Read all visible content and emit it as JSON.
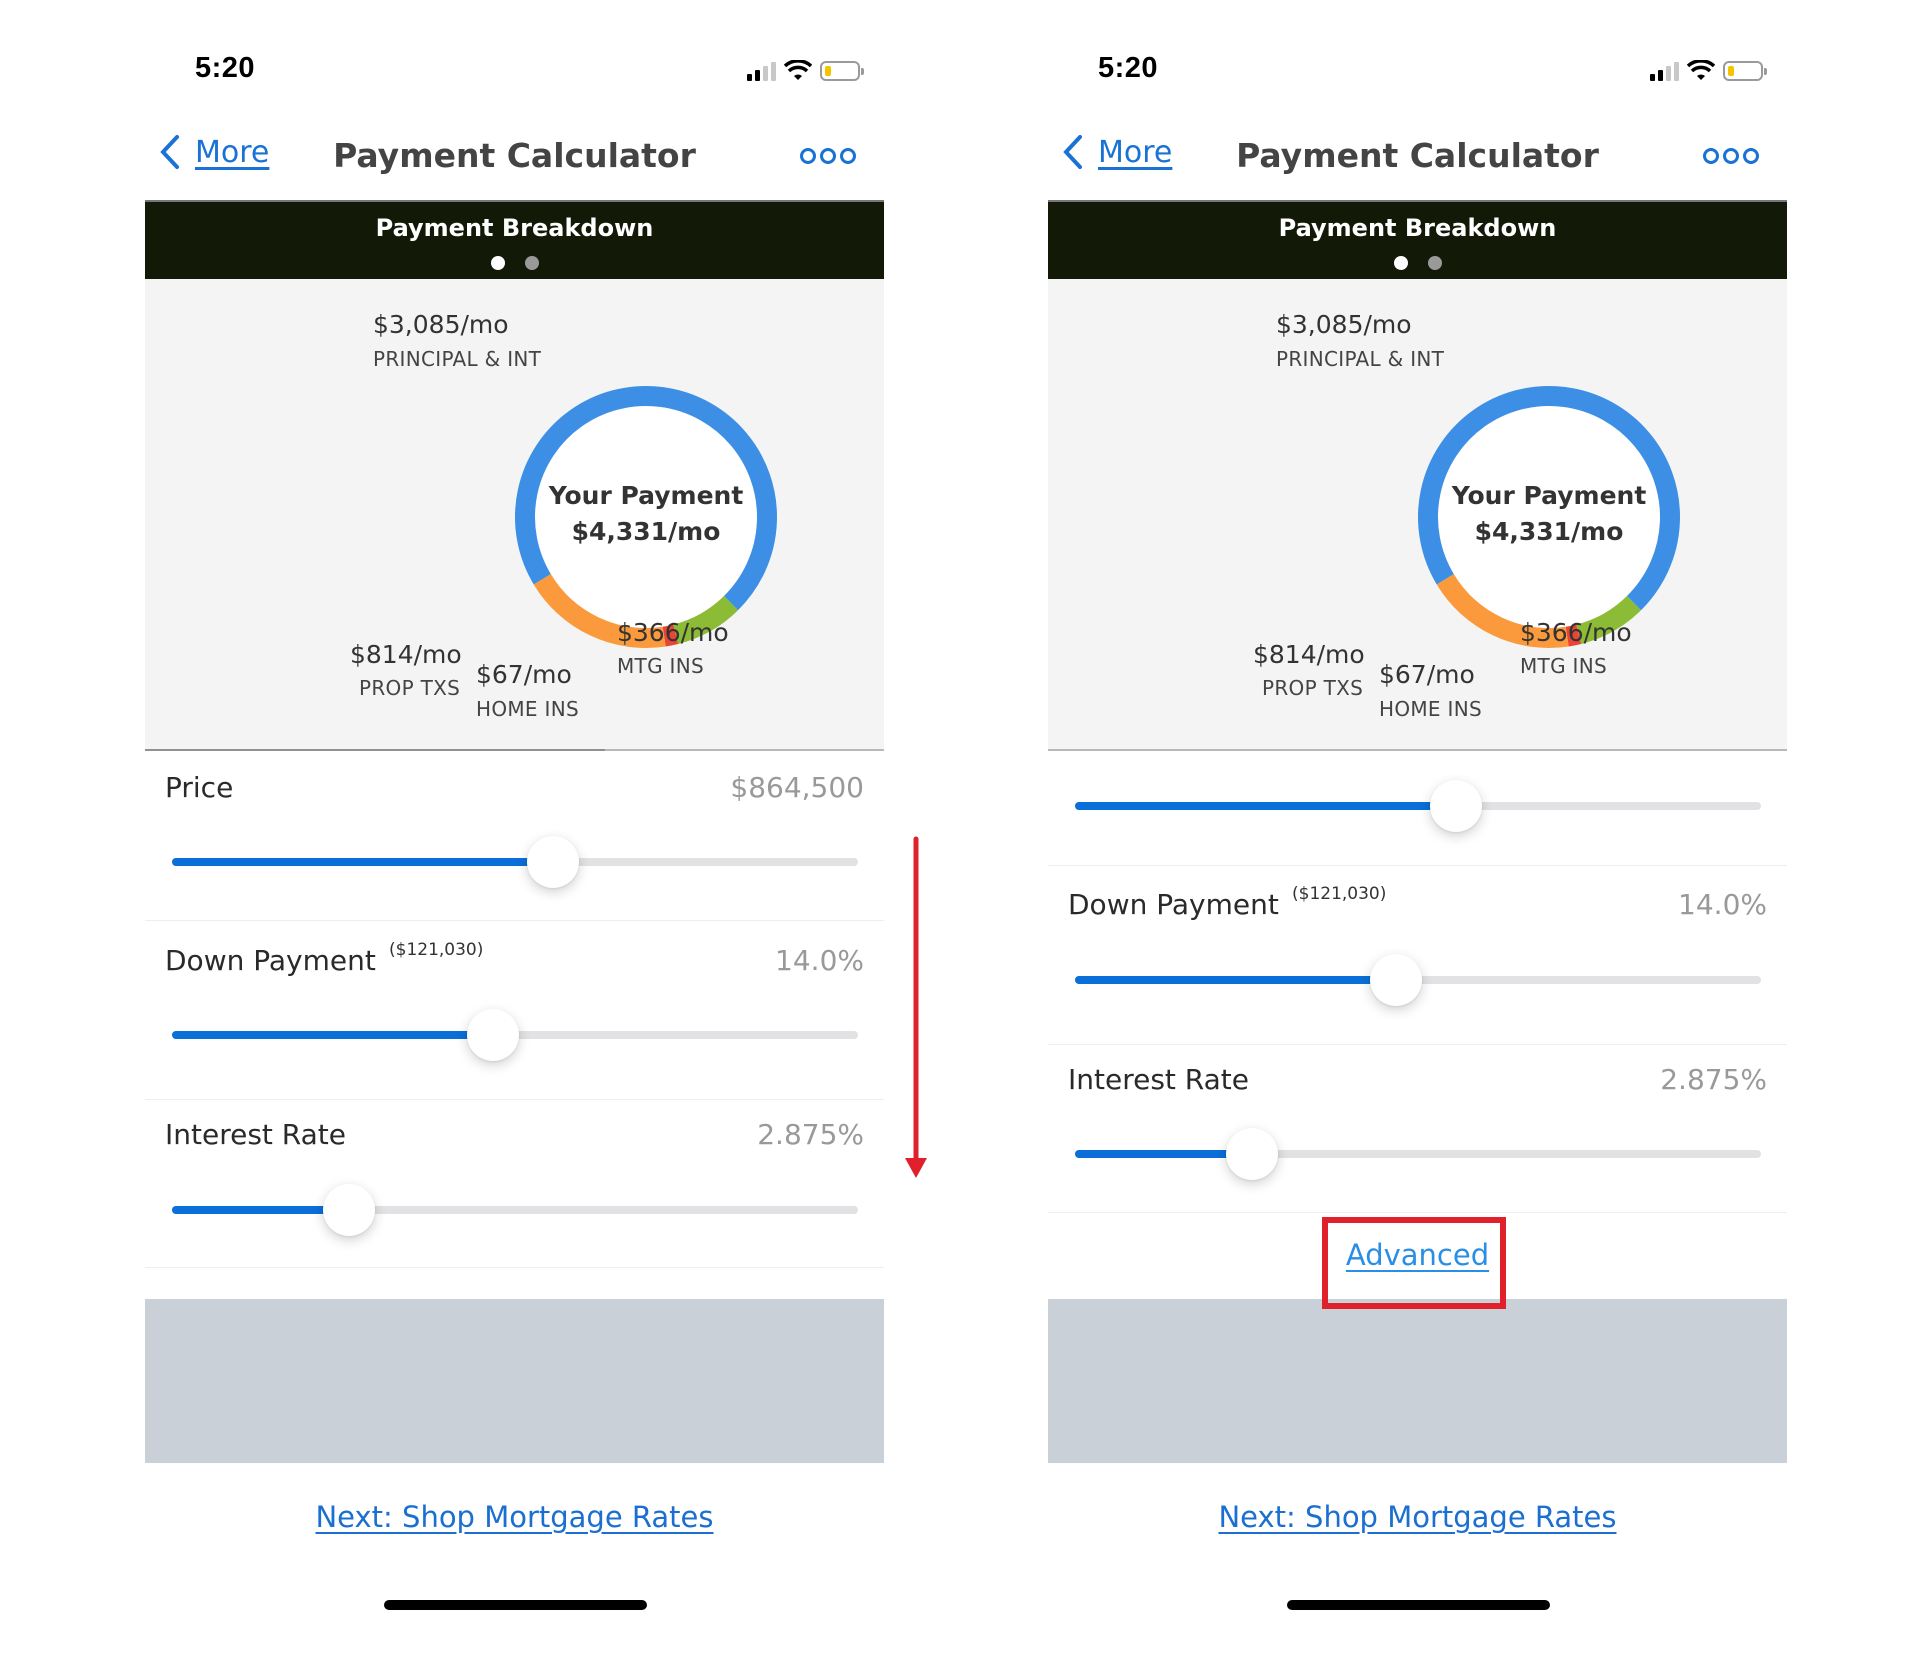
{
  "status_bar": {
    "time": "5:20",
    "signal_bars_on": 2,
    "signal_bars_total": 4,
    "battery_level": "low",
    "battery_color": "#f5c400"
  },
  "nav": {
    "back_label": "More",
    "title": "Payment Calculator",
    "menu_icon": "more-dots-icon"
  },
  "breakdown": {
    "title": "Payment Breakdown",
    "page_dots": 2,
    "active_dot": 0,
    "center_title": "Your Payment",
    "center_amount": "$4,331/mo",
    "segments": [
      {
        "key": "principal",
        "amount": "$3,085/mo",
        "label": "PRINCIPAL & INT",
        "value": 3085,
        "color": "#3d8fe6"
      },
      {
        "key": "mtg_ins",
        "amount": "$366/mo",
        "label": "MTG INS",
        "value": 366,
        "color": "#8cbb35"
      },
      {
        "key": "home_ins",
        "amount": "$67/mo",
        "label": "HOME INS",
        "value": 67,
        "color": "#ea4435"
      },
      {
        "key": "prop_tax",
        "amount": "$814/mo",
        "label": "PROP TXS",
        "value": 814,
        "color": "#fb9a3c"
      }
    ]
  },
  "inputs": {
    "price": {
      "label": "Price",
      "value": "$864,500",
      "fraction": 0.555
    },
    "down_payment": {
      "label": "Down Payment",
      "sub": "($121,030)",
      "value": "14.0%",
      "fraction": 0.468
    },
    "interest_rate": {
      "label": "Interest Rate",
      "value": "2.875%",
      "fraction": 0.258
    }
  },
  "advanced_label": "Advanced",
  "next_link": "Next: Shop Mortgage Rates",
  "annotations": {
    "arrow_color": "#e0202a",
    "highlight_color": "#e0202a"
  }
}
